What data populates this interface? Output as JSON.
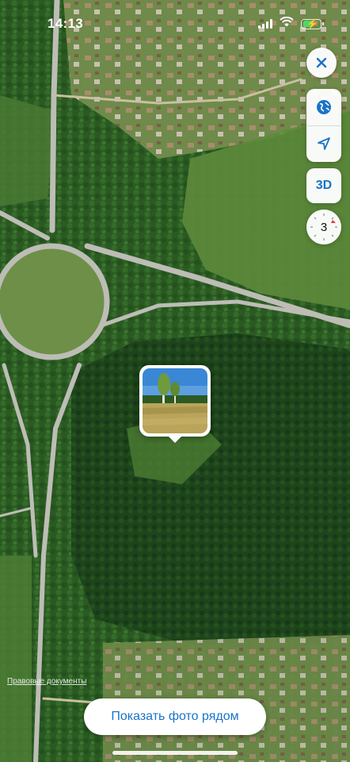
{
  "status_bar": {
    "time": "14:13",
    "icons": [
      "cellular-signal-icon",
      "wifi-icon",
      "battery-charging-icon"
    ]
  },
  "map": {
    "type": "satellite",
    "features": [
      "forest",
      "village",
      "roundabout",
      "highway",
      "meadow"
    ],
    "colors": {
      "forest_dark": "#1f4a1c",
      "forest": "#2f5e25",
      "meadow": "#5f8a3d",
      "road": "#b8b8b2",
      "village": "#8a7a5c"
    }
  },
  "controls": {
    "close_icon": "close-icon",
    "globe_icon": "globe-icon",
    "location_icon": "location-arrow-icon",
    "three_d_label": "3D",
    "compass_value": "3"
  },
  "photo_pin": {
    "icon": "photo-thumbnail",
    "colors": {
      "sky": "#3a87d6",
      "grass": "#b9a45a"
    }
  },
  "footer": {
    "legal_link": "Правовые документы",
    "show_photos_label": "Показать фото рядом"
  }
}
